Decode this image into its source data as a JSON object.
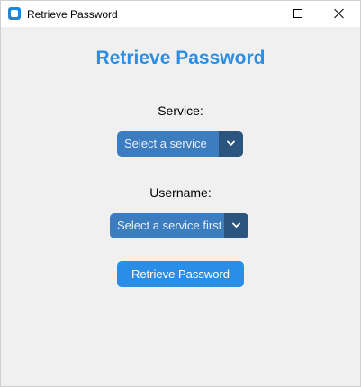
{
  "window": {
    "title": "Retrieve Password",
    "minimize_icon": "minimize-icon",
    "maximize_icon": "maximize-icon",
    "close_icon": "close-icon"
  },
  "main": {
    "heading": "Retrieve Password",
    "service": {
      "label": "Service:",
      "selected": "Select a service",
      "icon": "chevron-down-icon"
    },
    "username": {
      "label": "Username:",
      "selected": "Select a service first",
      "icon": "chevron-down-icon"
    },
    "retrieve_button": "Retrieve Password"
  },
  "colors": {
    "accent": "#2a8ee6",
    "combo_background": "#3c7dbf",
    "combo_arrow_background": "#2b557f",
    "window_background": "#f0f0f0"
  }
}
